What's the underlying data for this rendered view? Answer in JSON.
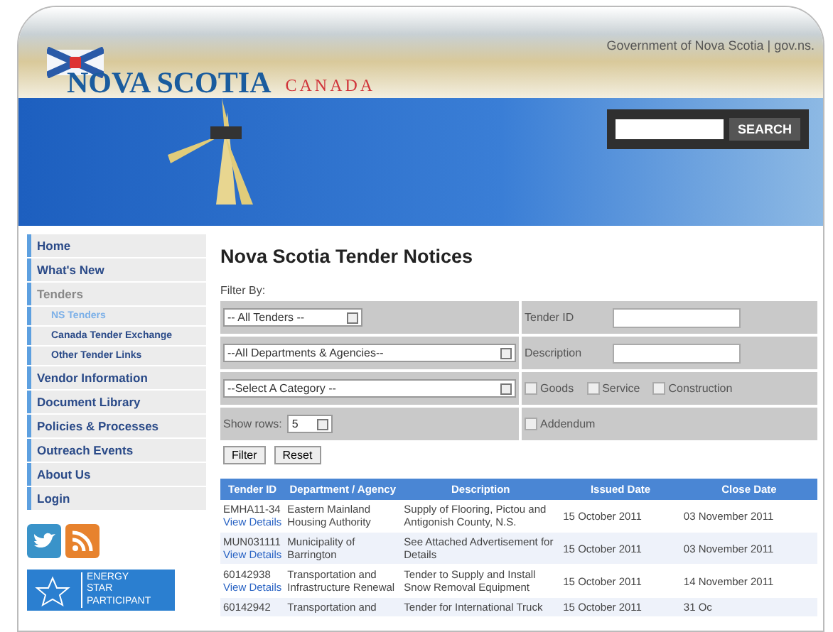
{
  "header": {
    "gov_link": "Government of Nova Scotia | gov.ns.",
    "logo": "NOVA SCOTIA",
    "logo_sub": "CANADA"
  },
  "search": {
    "button": "SEARCH"
  },
  "sidebar": {
    "items": [
      {
        "label": "Home",
        "selected": false
      },
      {
        "label": "What's New",
        "selected": false
      },
      {
        "label": "Tenders",
        "selected": false,
        "expanded": true,
        "children": [
          {
            "label": "NS Tenders",
            "selected": true
          },
          {
            "label": "Canada Tender Exchange",
            "selected": false
          },
          {
            "label": "Other Tender Links",
            "selected": false
          }
        ]
      },
      {
        "label": "Vendor Information",
        "selected": false
      },
      {
        "label": "Document Library",
        "selected": false
      },
      {
        "label": "Policies & Processes",
        "selected": false
      },
      {
        "label": "Outreach Events",
        "selected": false
      },
      {
        "label": "About Us",
        "selected": false
      },
      {
        "label": "Login",
        "selected": false
      }
    ],
    "badge": [
      "ENERGY",
      "STAR",
      "PARTICIPANT"
    ]
  },
  "main": {
    "title": "Nova Scotia Tender Notices",
    "filter_label": "Filter By:",
    "tender_select": "-- All Tenders --",
    "department_select": "--All Departments & Agencies--",
    "category_select": "--Select A Category --",
    "show_rows_label": "Show rows:",
    "show_rows_value": "5",
    "tender_id_label": "Tender ID",
    "description_label": "Description",
    "checkboxes": [
      {
        "label": "Goods",
        "checked": false
      },
      {
        "label": "Service",
        "checked": false
      },
      {
        "label": "Construction",
        "checked": false
      }
    ],
    "addendum": {
      "label": "Addendum",
      "checked": false
    },
    "buttons": [
      "Filter",
      "Reset"
    ]
  },
  "table": {
    "columns": [
      "Tender ID",
      "Department / Agency",
      "Description",
      "Issued Date",
      "Close Date"
    ],
    "rows": [
      {
        "id": "EMHA11-34",
        "link": "View Details",
        "department": "Eastern Mainland Housing Authority",
        "description": "Supply of Flooring, Pictou and Antigonish County, N.S.",
        "issued": "15 October 2011",
        "close": "03 November 2011"
      },
      {
        "id": "MUN031111",
        "link": "View Details",
        "department": "Municipality of Barrington",
        "description": "See Attached Advertisement for Details",
        "issued": "15 October 2011",
        "close": "03 November 2011"
      },
      {
        "id": "60142938",
        "link": "View Details",
        "department": "Transportation and Infrastructure Renewal",
        "description": "Tender to Supply and Install Snow Removal Equipment",
        "issued": "15 October 2011",
        "close": "14 November 2011"
      },
      {
        "id": "60142942",
        "link": "",
        "department": "Transportation and",
        "description": "Tender for International Truck",
        "issued": "15 October 2011",
        "close": "31 Oc"
      }
    ]
  }
}
